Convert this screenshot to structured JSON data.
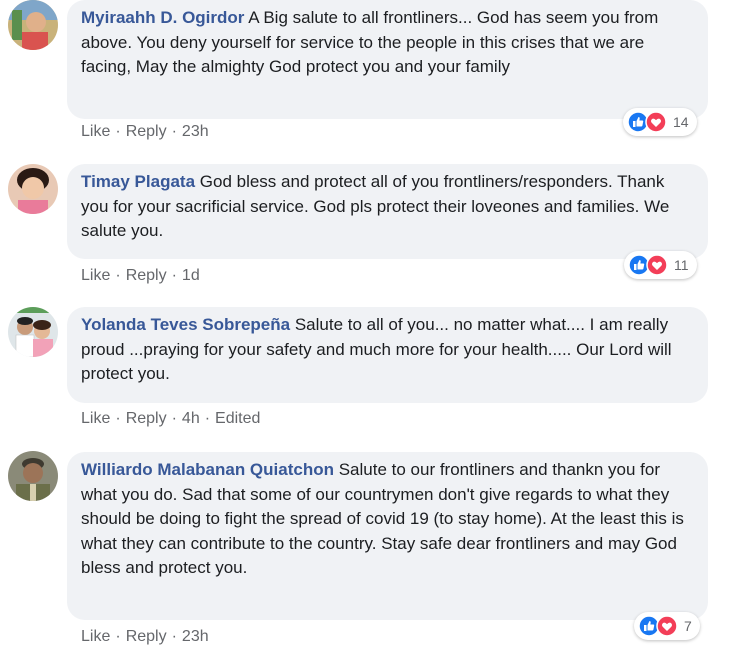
{
  "comments": [
    {
      "author": "Myiraahh D. Ogirdor",
      "text": "A Big salute to all frontliners... God has seem you from above. You deny yourself for service to the people in this crises that we are facing, May the almighty God protect you and your family",
      "actions": {
        "like": "Like",
        "reply": "Reply",
        "time": "23h"
      },
      "reaction_count": "14",
      "reactions": [
        "like-icon",
        "love-icon"
      ]
    },
    {
      "author": "Timay Plagata",
      "text": "God bless and protect all of you frontliners/responders. Thank you for your sacrificial service. God pls protect their loveones and families. We salute you.",
      "actions": {
        "like": "Like",
        "reply": "Reply",
        "time": "1d"
      },
      "reaction_count": "11",
      "reactions": [
        "like-icon",
        "love-icon"
      ]
    },
    {
      "author": "Yolanda Teves Sobrepeña",
      "text": "Salute to all of you... no matter what.... I am really proud ...praying for your safety and much more for your health..... Our Lord will protect you.",
      "actions": {
        "like": "Like",
        "reply": "Reply",
        "time": "4h",
        "edited": "Edited"
      }
    },
    {
      "author": "Williardo Malabanan Quiatchon",
      "text": "Salute to our frontliners and thankn you for what you do. Sad that some of our countrymen don't give regards to what they should be doing to fight the spread of covid 19 (to stay home). At the least this is what they can contribute to the country. Stay safe dear frontliners and may God bless and protect you.",
      "actions": {
        "like": "Like",
        "reply": "Reply",
        "time": "23h"
      },
      "reaction_count": "7",
      "reactions": [
        "like-icon",
        "love-icon"
      ]
    }
  ],
  "colors": {
    "author": "#385898",
    "bubble": "#f0f2f5",
    "meta": "#65676b",
    "like": "#1877f2",
    "love": "#f33e58"
  }
}
